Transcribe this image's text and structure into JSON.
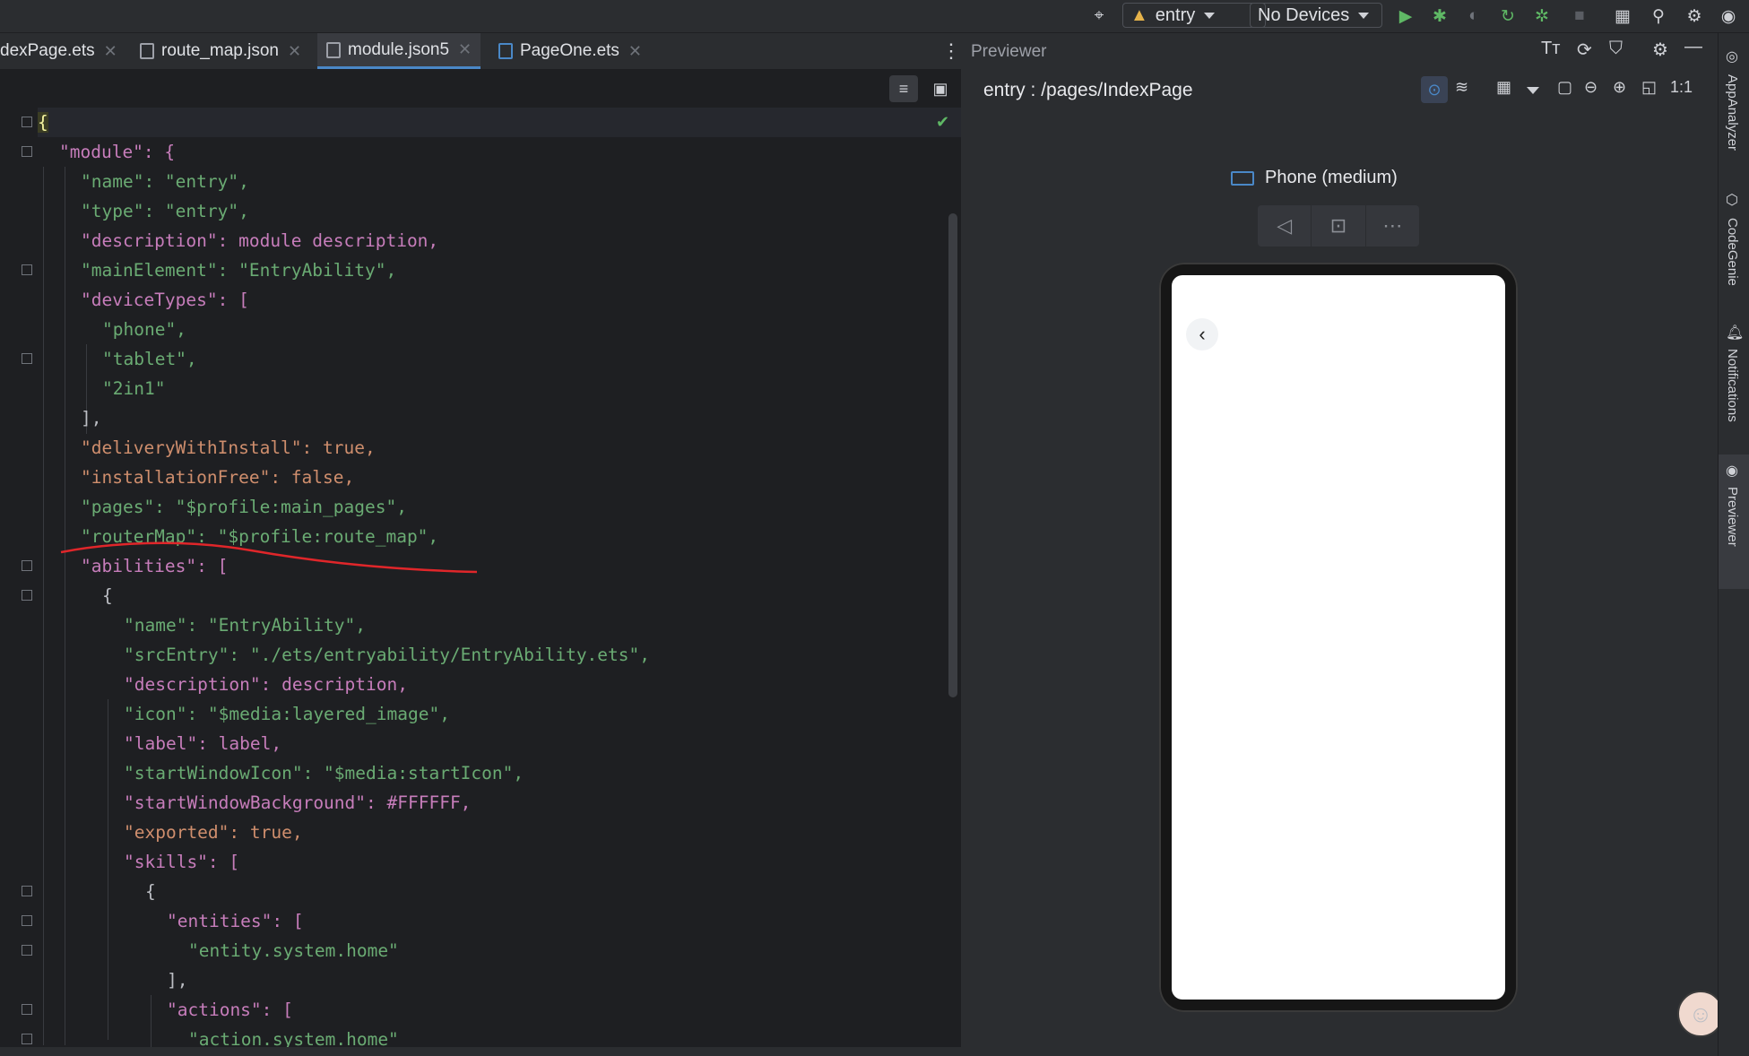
{
  "toolbar": {
    "run_config": "entry",
    "device": "No Devices",
    "icons": [
      "target-icon",
      "run-icon",
      "debug-icon",
      "profile-icon",
      "sync-icon",
      "attach-debugger-icon",
      "stop-icon",
      "project-structure-icon",
      "search-icon",
      "settings-icon",
      "account-icon"
    ]
  },
  "tabs": [
    {
      "label": "IndexPage.ets",
      "shown": "dexPage.ets",
      "active": false
    },
    {
      "label": "route_map.json",
      "active": false
    },
    {
      "label": "module.json5",
      "active": true
    },
    {
      "label": "PageOne.ets",
      "active": false
    }
  ],
  "code": [
    "{",
    "\"module\": {",
    "\"name\": \"entry\",",
    "\"type\": \"entry\",",
    "\"description\": module description,",
    "\"mainElement\": \"EntryAbility\",",
    "\"deviceTypes\": [",
    "\"phone\",",
    "\"tablet\",",
    "\"2in1\"",
    "],",
    "\"deliveryWithInstall\": true,",
    "\"installationFree\": false,",
    "\"pages\": \"$profile:main_pages\",",
    "\"routerMap\": \"$profile:route_map\",",
    "\"abilities\": [",
    "{",
    "\"name\": \"EntryAbility\",",
    "\"srcEntry\": \"./ets/entryability/EntryAbility.ets\",",
    "\"description\": description,",
    "\"icon\": \"$media:layered_image\",",
    "\"label\": label,",
    "\"startWindowIcon\": \"$media:startIcon\",",
    "\"startWindowBackground\": #FFFFFF,",
    "\"exported\": true,",
    "\"skills\": [",
    "{",
    "\"entities\": [",
    "\"entity.system.home\"",
    "],",
    "\"actions\": [",
    "\"action.system.home\""
  ],
  "previewer": {
    "title": "Previewer",
    "page_path": "entry : /pages/IndexPage",
    "device_label": "Phone (medium)"
  },
  "right_strip": [
    "AppAnalyzer",
    "CodeGenie",
    "Notifications",
    "Previewer"
  ],
  "colors": {
    "accent": "#4a88c7",
    "annotation": "#e0262a",
    "string": "#6aab73",
    "keyword": "#cf8e6d"
  }
}
